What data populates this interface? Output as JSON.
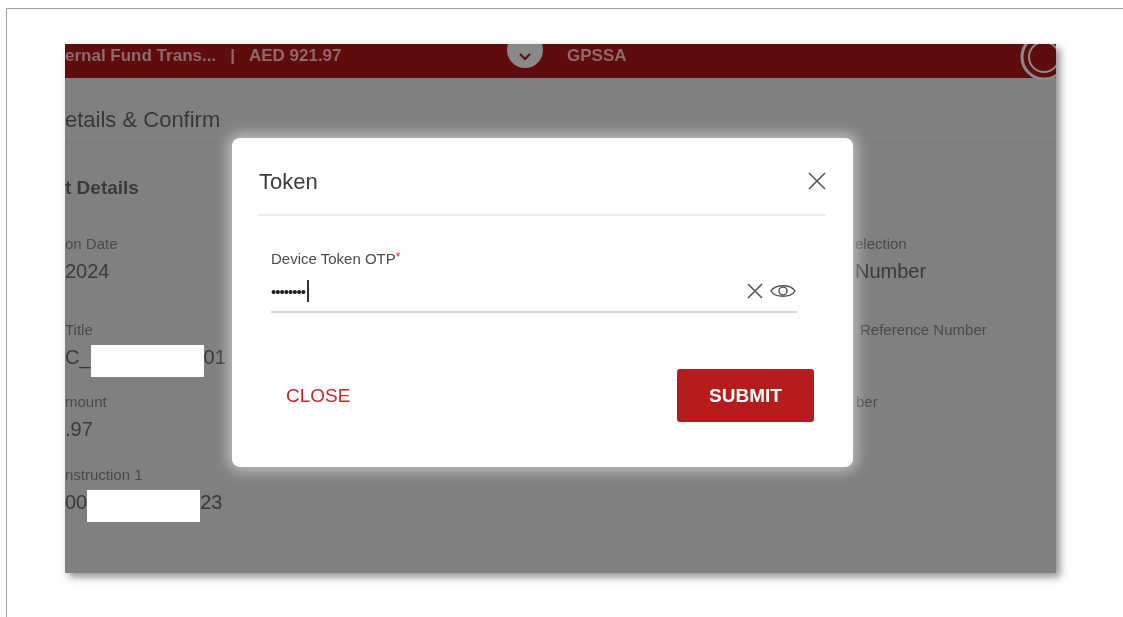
{
  "header": {
    "title": "ernal Fund Trans...",
    "separator": "|",
    "amount": "AED 921.97",
    "beneficiary": "GPSSA"
  },
  "page_title": "etails & Confirm",
  "section_title": "t Details",
  "left_fields": [
    {
      "label": "on Date",
      "value": "2024",
      "redacted": false
    },
    {
      "label": "Title",
      "value": "C_",
      "value_end": "01",
      "redacted": true
    },
    {
      "label": "mount",
      "value": ".97",
      "redacted": false
    },
    {
      "label": "nstruction 1",
      "value": "00",
      "value_end": "23",
      "redacted": true
    }
  ],
  "right_fields": [
    {
      "label": "election",
      "value": "Number"
    },
    {
      "label": "Reference Number"
    },
    {
      "label": "ber"
    }
  ],
  "dialog": {
    "title": "Token",
    "field": {
      "label": "Device Token OTP",
      "required_mark": "*",
      "value": "••••••••",
      "focused": true
    },
    "buttons": [
      {
        "label": "CLOSE",
        "kind": "text"
      },
      {
        "label": "SUBMIT",
        "kind": "primary"
      }
    ]
  }
}
